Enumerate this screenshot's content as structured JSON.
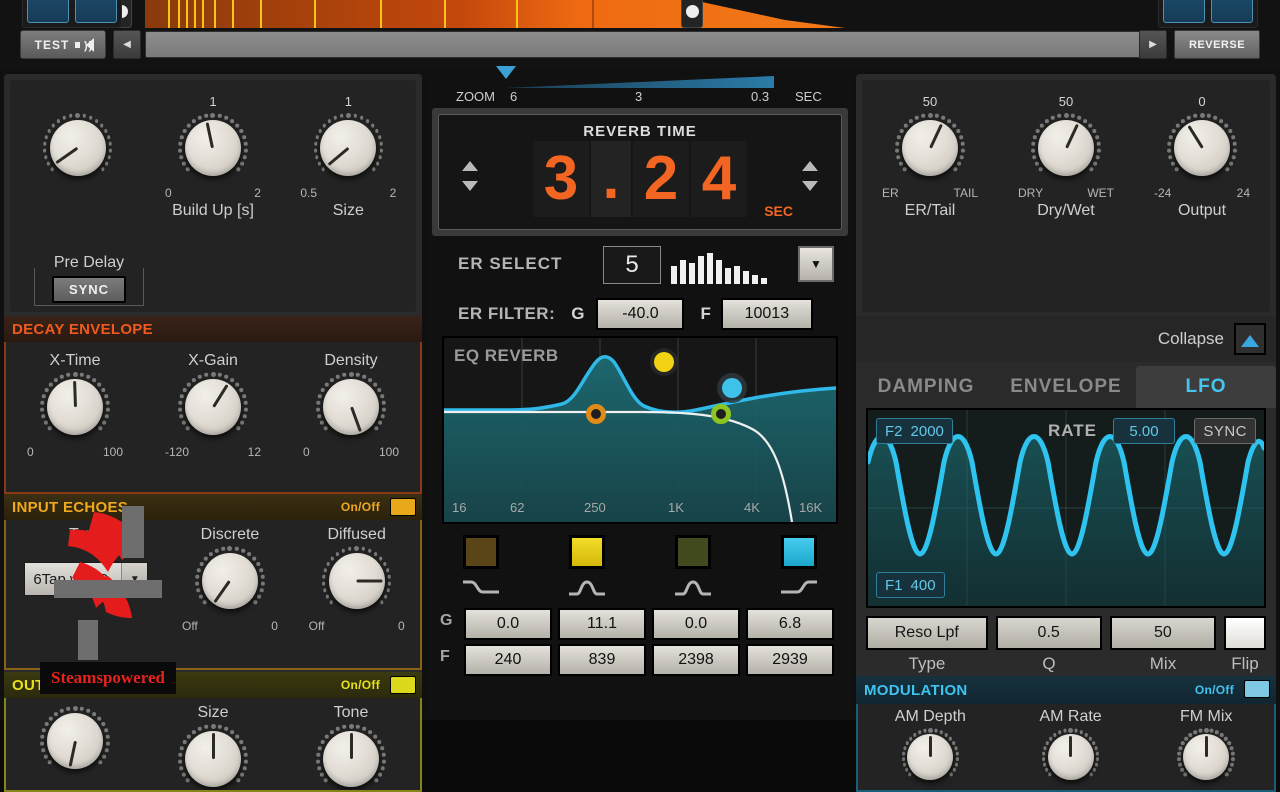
{
  "topbar": {
    "test_label": "TEST",
    "reverse_label": "REVERSE",
    "left_arrow": "◀",
    "right_arrow": "▶",
    "speaker_icon": "speaker-icon"
  },
  "left_panel": {
    "knobs": [
      {
        "name": "Pre Delay",
        "top_value": "",
        "min": "",
        "max": "",
        "angle": -125
      },
      {
        "name": "Build Up [s]",
        "top_value": "1",
        "min": "0",
        "max": "2",
        "angle": -12
      },
      {
        "name": "Size",
        "top_value": "1",
        "min": "0.5",
        "max": "2",
        "angle": -130
      }
    ],
    "predelay_group_label": "Pre Delay",
    "sync_label": "SYNC",
    "decay": {
      "title": "DECAY ENVELOPE",
      "knobs": [
        {
          "name": "X-Time",
          "min": "0",
          "max": "100",
          "angle": -2
        },
        {
          "name": "X-Gain",
          "min": "-120",
          "max": "12",
          "angle": 32
        },
        {
          "name": "Density",
          "min": "0",
          "max": "100",
          "angle": 160
        }
      ]
    },
    "input_echoes": {
      "title": "INPUT ECHOES",
      "onoff_label": "On/Off",
      "led_color": "#e8a81a",
      "type_label": "Type",
      "type_value": "6Tap w/ FB",
      "knobs": [
        {
          "name": "Discrete",
          "min": "Off",
          "max": "0",
          "angle": -145
        },
        {
          "name": "Diffused",
          "min": "Off",
          "max": "0",
          "angle": 90
        }
      ]
    },
    "output_echoes": {
      "title": "OUTPUT ECHOES",
      "onoff_label": "On/Off",
      "led_color": "#dcd81c",
      "knobs": [
        {
          "name": "",
          "angle": -168
        },
        {
          "name": "Size",
          "angle": 0
        },
        {
          "name": "Tone",
          "angle": 0
        }
      ]
    }
  },
  "center_panel": {
    "zoom": {
      "label": "ZOOM",
      "unit": "SEC",
      "ticks": [
        "6",
        "3",
        "0.3"
      ],
      "value": "6"
    },
    "reverb_time": {
      "title": "REVERB TIME",
      "digits": [
        "3",
        ".",
        "2",
        "4"
      ],
      "unit": "SEC",
      "value": "3.24"
    },
    "er_select": {
      "label": "ER SELECT",
      "value": "5",
      "dropdown_icon": "chevron-down-icon"
    },
    "er_filter": {
      "label": "ER FILTER:",
      "g_label": "G",
      "g_value": "-40.0",
      "f_label": "F",
      "f_value": "10013"
    },
    "eq": {
      "title": "EQ REVERB",
      "freq_ticks": [
        "16",
        "62",
        "250",
        "1K",
        "4K",
        "16K"
      ],
      "bands": [
        {
          "color": "#5a4519",
          "icon": "low-shelf-icon",
          "g": "0.0",
          "f": "240"
        },
        {
          "color": "#e8cc15",
          "icon": "bell-icon",
          "g": "11.1",
          "f": "839"
        },
        {
          "color": "#41491f",
          "icon": "bell-icon",
          "g": "0.0",
          "f": "2398"
        },
        {
          "color": "#2fbce0",
          "icon": "high-shelf-icon",
          "g": "6.8",
          "f": "2939"
        }
      ],
      "g_row_label": "G",
      "f_row_label": "F",
      "node_colors": {
        "orange": "#e08a18",
        "yellow": "#f2d313",
        "green": "#8cc424",
        "blue": "#3ec2ea"
      },
      "curve_color": "#2fb8e8"
    }
  },
  "right_panel": {
    "knobs": [
      {
        "name": "ER/Tail",
        "top_value": "50",
        "min": "ER",
        "max": "TAIL",
        "angle": 25
      },
      {
        "name": "Dry/Wet",
        "top_value": "50",
        "min": "DRY",
        "max": "WET",
        "angle": 25
      },
      {
        "name": "Output",
        "top_value": "0",
        "min": "-24",
        "max": "24",
        "angle": -32
      }
    ],
    "collapse": {
      "label": "Collapse",
      "icon": "triangle-up-icon"
    },
    "tabs": [
      {
        "label": "DAMPING",
        "active": false
      },
      {
        "label": "ENVELOPE",
        "active": false
      },
      {
        "label": "LFO",
        "active": true
      }
    ],
    "lfo": {
      "f2_label": "F2",
      "f2_value": "2000",
      "f1_label": "F1",
      "f1_value": "400",
      "rate_label": "RATE",
      "rate_value": "5.00",
      "sync_label": "SYNC",
      "wave_color": "#2fc3f0",
      "cycles": 5
    },
    "reso": {
      "type_value": "Reso Lpf",
      "q_value": "0.5",
      "mix_value": "50",
      "type_label": "Type",
      "q_label": "Q",
      "mix_label": "Mix",
      "flip_label": "Flip"
    },
    "modulation": {
      "title": "MODULATION",
      "onoff_label": "On/Off",
      "led_color": "#7fc8e4",
      "knobs": [
        {
          "name": "AM Depth",
          "angle": 0
        },
        {
          "name": "AM Rate",
          "angle": 0
        },
        {
          "name": "FM Mix",
          "angle": 0
        }
      ]
    }
  },
  "watermark": {
    "text": "Steamspowered",
    "color": "#e8221c",
    "gear_color": "#e51c1c"
  }
}
